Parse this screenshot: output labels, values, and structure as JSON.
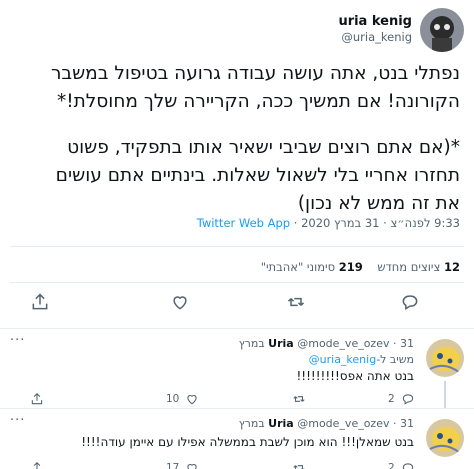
{
  "tweet": {
    "author_name": "uria kenig",
    "author_handle": "@uria_kenig",
    "lines": [
      "נפתלי בנט, אתה עושה עבודה גרועה בטיפול במשבר",
      "הקורונה! אם תמשיך ככה, הקריירה שלך מחוסלת!*"
    ],
    "lines2": [
      "*(אם אתם רוצים שביבי ישאיר אותו בתפקיד, פשוט",
      "תחזרו אחריי בלי לשאול שאלות. בינתיים אתם עושים",
      "את זה ממש לא נכון)"
    ],
    "time": "9:33 לפנה״צ",
    "date": "31 במרץ 2020",
    "app": "Twitter Web App",
    "retweets_count": "12",
    "retweets_label": "ציוצים מחדש",
    "likes_count": "219",
    "likes_label": "סימוני \"אהבתי\""
  },
  "replies": [
    {
      "name": "Uria",
      "handle": "@mode_ve_ozev",
      "date": "31 במרץ",
      "replying_prefix": "משיב ל-",
      "replying_to": "@uria_kenig",
      "text": "בנט אתה אפס!!!!!!!!!",
      "likes": "10",
      "replies": "2"
    },
    {
      "name": "Uria",
      "handle": "@mode_ve_ozev",
      "date": "31 במרץ",
      "text": "בנט שמאלן!!! הוא מוכן לשבת בממשלה אפילו עם איימן עודה!!!!",
      "likes": "17",
      "replies": "2"
    }
  ],
  "icons": [
    "reply-icon",
    "retweet-icon",
    "like-icon",
    "share-icon",
    "more-icon"
  ],
  "colors": {
    "accent": "#1d9bf0",
    "muted": "#536471",
    "text": "#0f1419",
    "border": "#e6ecf0"
  }
}
